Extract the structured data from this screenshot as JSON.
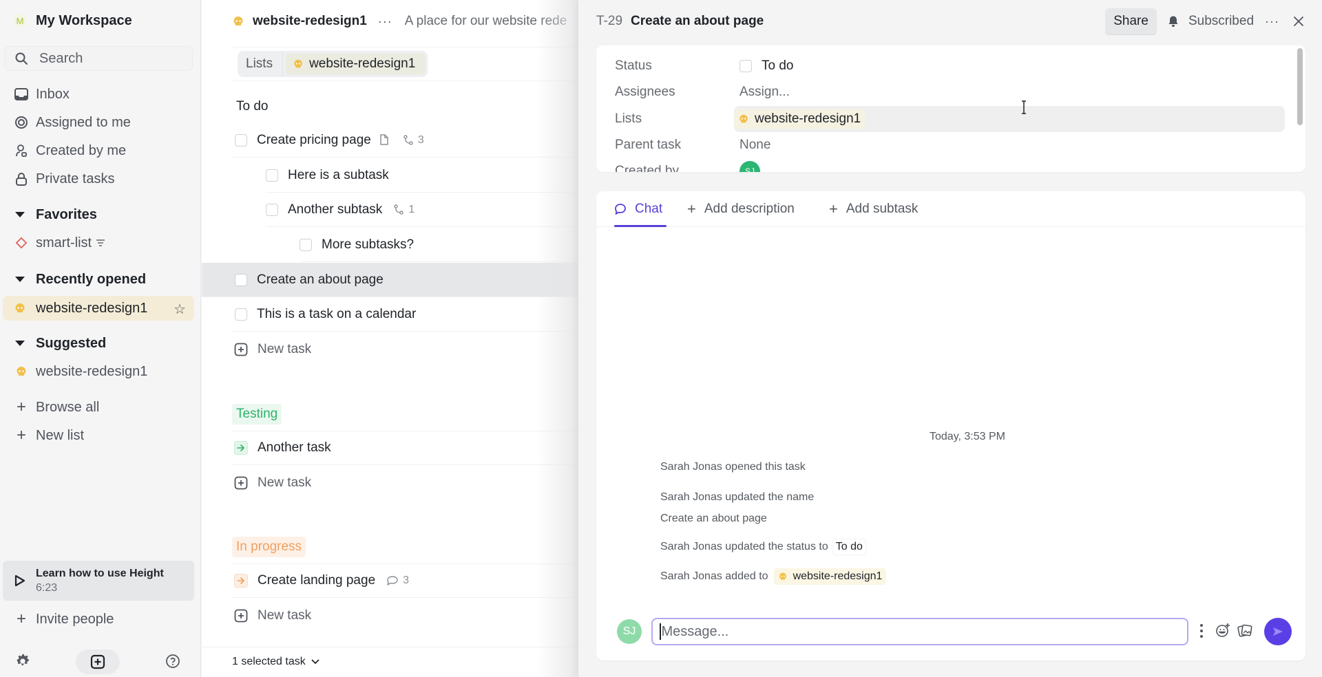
{
  "sidebar": {
    "workspace": {
      "initial": "M",
      "name": "My Workspace"
    },
    "search": {
      "label": "Search"
    },
    "nav": [
      {
        "label": "Inbox",
        "icon": "inbox-icon"
      },
      {
        "label": "Assigned to me",
        "icon": "target-icon"
      },
      {
        "label": "Created by me",
        "icon": "user-icon"
      },
      {
        "label": "Private tasks",
        "icon": "lock-icon"
      }
    ],
    "favorites": {
      "title": "Favorites",
      "items": [
        {
          "label": "smart-list",
          "icon": "diamond-icon",
          "badge_icon": "filter-icon"
        }
      ]
    },
    "recent": {
      "title": "Recently opened",
      "items": [
        {
          "label": "website-redesign1",
          "icon": "skull-icon",
          "active": true
        }
      ]
    },
    "suggested": {
      "title": "Suggested",
      "items": [
        {
          "label": "website-redesign1",
          "icon": "skull-icon"
        }
      ]
    },
    "browse_all": "Browse all",
    "new_list": "New list",
    "learn": {
      "title": "Learn how to use Height",
      "duration": "6:23"
    },
    "invite": "Invite people"
  },
  "main": {
    "list_name": "website-redesign1",
    "description": "A place for our website rede",
    "view_tabs": {
      "lists_label": "Lists",
      "current": "website-redesign1"
    },
    "groups": [
      {
        "label": "To do",
        "color": "#1f2328",
        "tasks": [
          {
            "title": "Create pricing page",
            "has_doc": true,
            "subtasks": "3"
          },
          {
            "title": "Here is a subtask",
            "level": 1
          },
          {
            "title": "Another subtask",
            "level": 1,
            "subtasks": "1"
          },
          {
            "title": "More subtasks?",
            "level": 2
          },
          {
            "title": "Create an about page",
            "selected": true
          },
          {
            "title": "This is a task on a calendar"
          }
        ],
        "new_task": "New task"
      },
      {
        "label": "Testing",
        "color": "#2fb36a",
        "tasks": [
          {
            "title": "Another task"
          }
        ],
        "new_task": "New task"
      },
      {
        "label": "In progress",
        "color": "#f0a060",
        "tasks": [
          {
            "title": "Create landing page",
            "comments": "3"
          }
        ],
        "new_task": "New task"
      }
    ],
    "footer": "1 selected task"
  },
  "detail": {
    "task_id": "T-29",
    "title": "Create an about page",
    "share_label": "Share",
    "subscribed_label": "Subscribed",
    "properties": [
      {
        "key": "Status",
        "value": "To do"
      },
      {
        "key": "Assignees",
        "value": "Assign..."
      },
      {
        "key": "Lists",
        "value": "website-redesign1"
      },
      {
        "key": "Parent task",
        "value": "None"
      },
      {
        "key": "Created by",
        "value": "SJ"
      }
    ],
    "tabs": [
      {
        "label": "Chat",
        "active": true
      },
      {
        "label": "Add description"
      },
      {
        "label": "Add subtask"
      }
    ],
    "activity": {
      "timestamp": "Today, 3:53 PM",
      "events": [
        {
          "text": "Sarah Jonas opened this task"
        },
        {
          "text": "Sarah Jonas updated the name",
          "detail": "Create an about page"
        },
        {
          "text": "Sarah Jonas updated the status to",
          "tag": "To do"
        },
        {
          "text": "Sarah Jonas added to",
          "chip": "website-redesign1"
        }
      ]
    },
    "composer": {
      "avatar": "SJ",
      "placeholder": "Message..."
    },
    "accent": "#5b3fd6"
  }
}
